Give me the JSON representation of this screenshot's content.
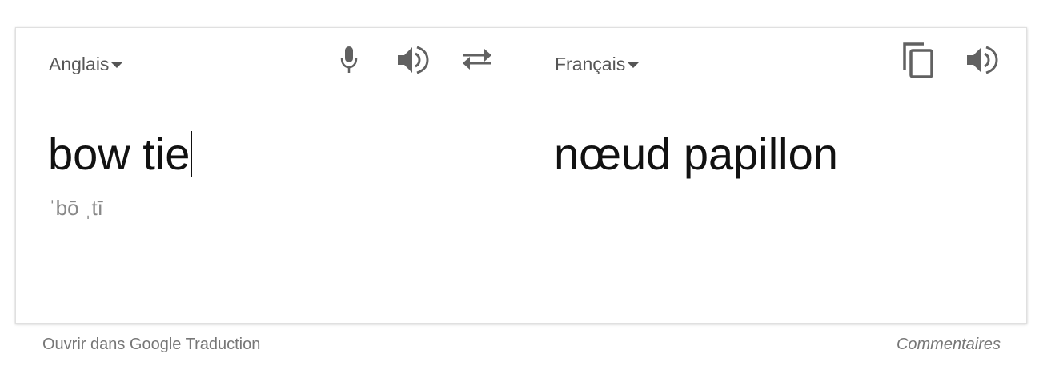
{
  "source": {
    "language": "Anglais",
    "text": "bow tie",
    "phonetic": "ˈbō ˌtī"
  },
  "target": {
    "language": "Français",
    "text": "nœud papillon"
  },
  "icons": {
    "mic": "microphone-icon",
    "speaker": "speaker-icon",
    "swap": "swap-icon",
    "copy": "copy-icon"
  },
  "colors": {
    "icon": "#616161",
    "text": "#111111",
    "muted": "#777777"
  },
  "footer": {
    "open_link": "Ouvrir dans Google Traduction",
    "feedback": "Commentaires"
  }
}
